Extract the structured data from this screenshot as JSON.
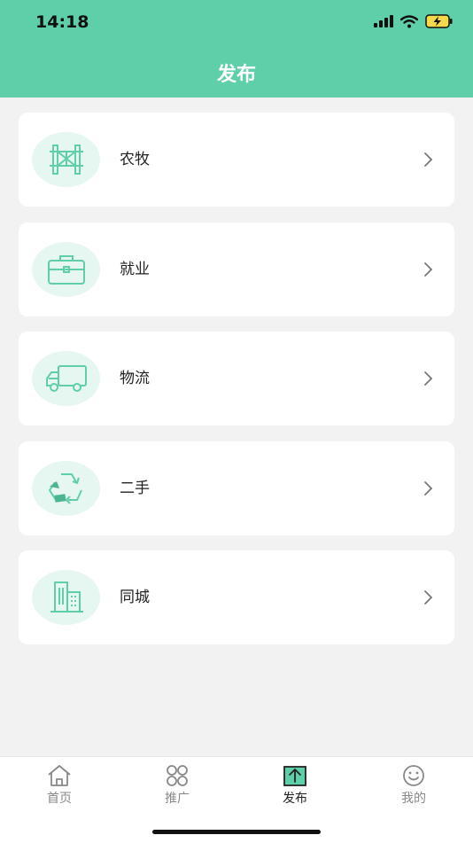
{
  "status_bar": {
    "time": "14:18"
  },
  "header": {
    "title": "发布"
  },
  "categories": [
    {
      "label": "农牧",
      "icon": "fence-icon"
    },
    {
      "label": "就业",
      "icon": "briefcase-icon"
    },
    {
      "label": "物流",
      "icon": "truck-icon"
    },
    {
      "label": "二手",
      "icon": "recycle-icon"
    },
    {
      "label": "同城",
      "icon": "buildings-icon"
    }
  ],
  "tabbar": {
    "items": [
      {
        "label": "首页",
        "icon": "home-icon"
      },
      {
        "label": "推广",
        "icon": "grid-icon"
      },
      {
        "label": "发布",
        "icon": "upload-icon",
        "active": true
      },
      {
        "label": "我的",
        "icon": "smile-icon"
      }
    ]
  },
  "colors": {
    "accent": "#5ecfa8",
    "icon_bg": "#e6f6f0",
    "icon_stroke": "#5ecfa8"
  }
}
